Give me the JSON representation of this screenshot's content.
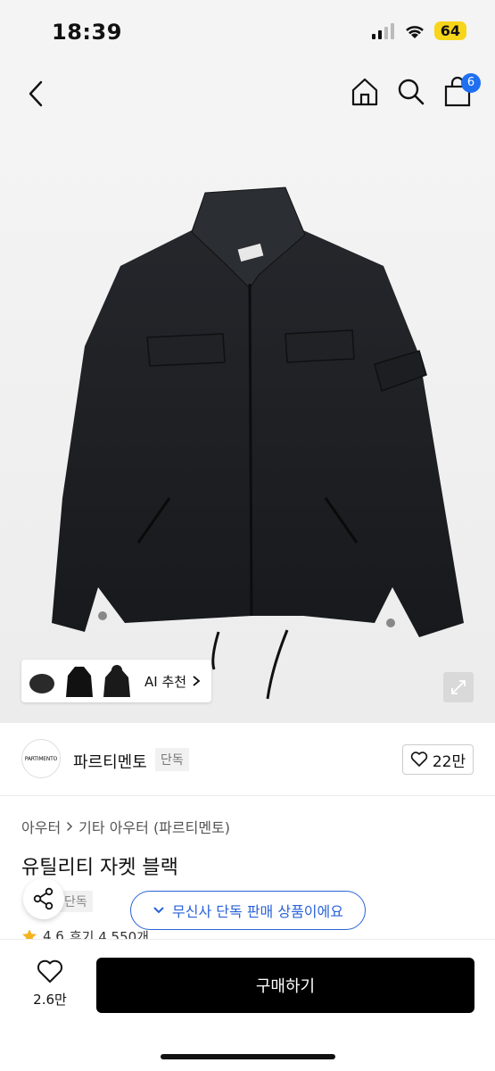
{
  "status": {
    "time": "18:39",
    "battery": "64"
  },
  "nav": {
    "cart_count": "6"
  },
  "gallery": {
    "ai_recommend_label": "AI 추천"
  },
  "brand": {
    "logo_text": "PARTIMENTO",
    "name": "파르티멘토",
    "tag": "단독",
    "likes": "22만"
  },
  "breadcrumb": {
    "category": "아우터",
    "subcategory": "기타 아우터 (파르티멘토)"
  },
  "product": {
    "title": "유틸리티 자켓 블랙",
    "exclusive_tag": "단독",
    "rating": "4.6",
    "reviews": "후기 4,550개"
  },
  "toast": {
    "message": "무신사 단독 판매 상품이에요"
  },
  "bottom": {
    "wish_count": "2.6만",
    "buy_label": "구매하기"
  },
  "colors": {
    "accent": "#2a63d8",
    "badge": "#1e6ff1",
    "battery": "#f7d51a"
  }
}
